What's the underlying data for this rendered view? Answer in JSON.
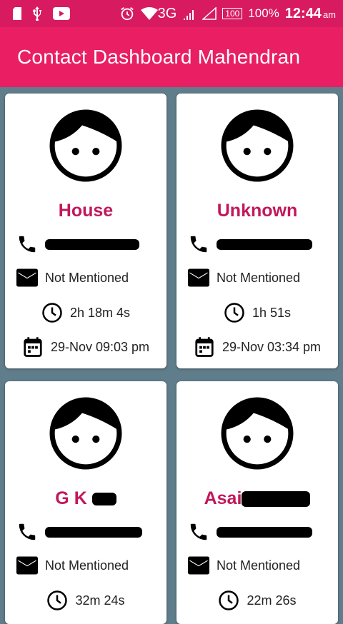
{
  "status_bar": {
    "network": "3G",
    "battery_box": "100",
    "battery_percent": "100%",
    "time": "12:44",
    "ampm": "am"
  },
  "app_bar": {
    "title": "Contact Dashboard Mahendran"
  },
  "colors": {
    "status_bar": "#D81B60",
    "app_bar": "#E91E63",
    "name": "#C2185B",
    "background": "#607D8B"
  },
  "cards": [
    {
      "name": "House",
      "email": "Not Mentioned",
      "duration": "2h 18m 4s",
      "date": "29-Nov 09:03 pm",
      "phone_redacted": true
    },
    {
      "name": "Unknown",
      "email": "Not Mentioned",
      "duration": "1h 51s",
      "date": "29-Nov 03:34 pm",
      "phone_redacted": true
    },
    {
      "name": "G K",
      "email": "Not Mentioned",
      "duration": "32m 24s",
      "date": "",
      "phone_redacted": true
    },
    {
      "name": "Asai",
      "email": "Not Mentioned",
      "duration": "22m 26s",
      "date": "",
      "phone_redacted": true
    }
  ]
}
